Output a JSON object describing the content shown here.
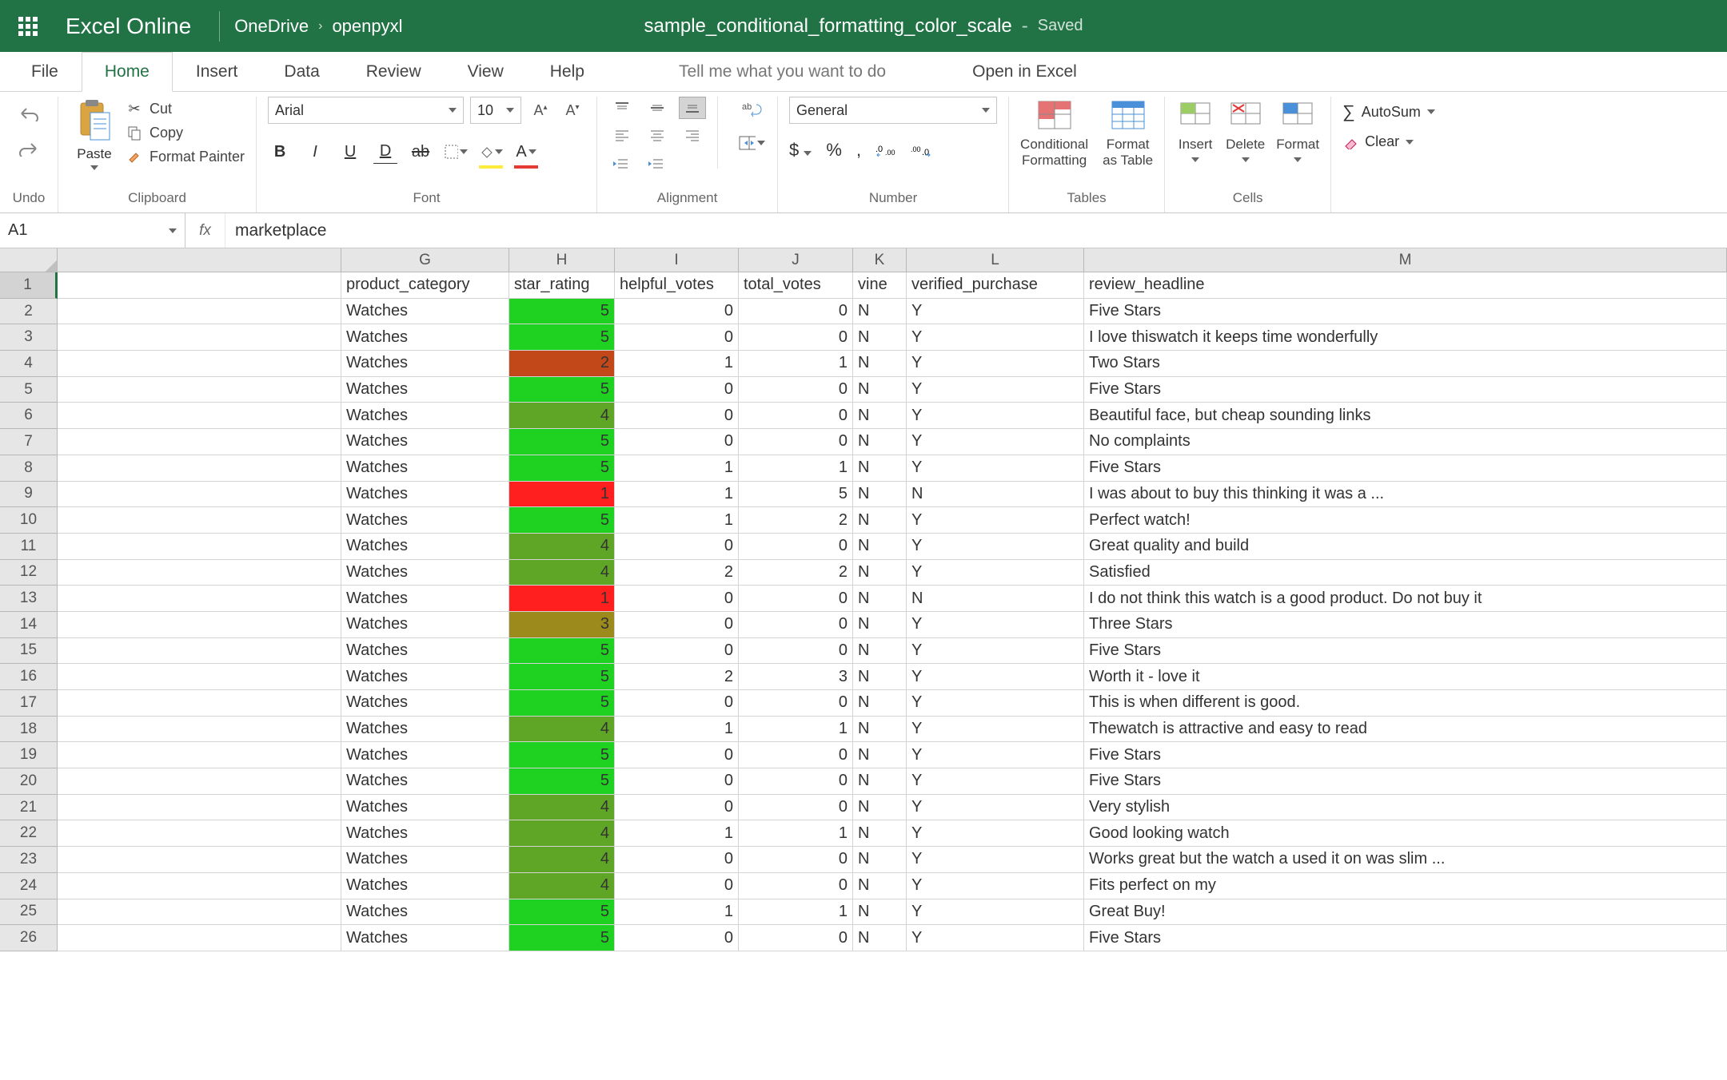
{
  "titlebar": {
    "app_name": "Excel Online",
    "breadcrumb": [
      "OneDrive",
      "openpyxl"
    ],
    "doc_name": "sample_conditional_formatting_color_scale",
    "status": "Saved"
  },
  "tabs": {
    "items": [
      "File",
      "Home",
      "Insert",
      "Data",
      "Review",
      "View",
      "Help"
    ],
    "active": "Home",
    "tell_me": "Tell me what you want to do",
    "open_in_excel": "Open in Excel"
  },
  "ribbon": {
    "undo_label": "Undo",
    "clipboard": {
      "label": "Clipboard",
      "paste": "Paste",
      "cut": "Cut",
      "copy": "Copy",
      "format_painter": "Format Painter"
    },
    "font": {
      "label": "Font",
      "name": "Arial",
      "size": "10"
    },
    "alignment": {
      "label": "Alignment"
    },
    "number": {
      "label": "Number",
      "format": "General"
    },
    "tables": {
      "label": "Tables",
      "conditional_formatting": "Conditional\nFormatting",
      "format_as_table": "Format\nas Table"
    },
    "cells": {
      "label": "Cells",
      "insert": "Insert",
      "delete": "Delete",
      "format": "Format"
    },
    "editing": {
      "autosum": "AutoSum",
      "clear": "Clear"
    }
  },
  "formula_bar": {
    "cell_ref": "A1",
    "fx": "fx",
    "value": "marketplace"
  },
  "columns": [
    "G",
    "H",
    "I",
    "J",
    "K",
    "L",
    "M"
  ],
  "headers": {
    "G": "product_category",
    "H": "star_rating",
    "I": "helpful_votes",
    "J": "total_votes",
    "K": "vine",
    "L": "verified_purchase",
    "M": "review_headline"
  },
  "rows": [
    {
      "n": 2,
      "G": "Watches",
      "H": 5,
      "I": 0,
      "J": 0,
      "K": "N",
      "L": "Y",
      "M": "Five Stars"
    },
    {
      "n": 3,
      "G": "Watches",
      "H": 5,
      "I": 0,
      "J": 0,
      "K": "N",
      "L": "Y",
      "M": "I love thiswatch it keeps time wonderfully"
    },
    {
      "n": 4,
      "G": "Watches",
      "H": 2,
      "I": 1,
      "J": 1,
      "K": "N",
      "L": "Y",
      "M": "Two Stars"
    },
    {
      "n": 5,
      "G": "Watches",
      "H": 5,
      "I": 0,
      "J": 0,
      "K": "N",
      "L": "Y",
      "M": "Five Stars"
    },
    {
      "n": 6,
      "G": "Watches",
      "H": 4,
      "I": 0,
      "J": 0,
      "K": "N",
      "L": "Y",
      "M": "Beautiful face, but cheap sounding links"
    },
    {
      "n": 7,
      "G": "Watches",
      "H": 5,
      "I": 0,
      "J": 0,
      "K": "N",
      "L": "Y",
      "M": "No complaints"
    },
    {
      "n": 8,
      "G": "Watches",
      "H": 5,
      "I": 1,
      "J": 1,
      "K": "N",
      "L": "Y",
      "M": "Five Stars"
    },
    {
      "n": 9,
      "G": "Watches",
      "H": 1,
      "I": 1,
      "J": 5,
      "K": "N",
      "L": "N",
      "M": "I was about to buy this thinking it was a ..."
    },
    {
      "n": 10,
      "G": "Watches",
      "H": 5,
      "I": 1,
      "J": 2,
      "K": "N",
      "L": "Y",
      "M": "Perfect watch!"
    },
    {
      "n": 11,
      "G": "Watches",
      "H": 4,
      "I": 0,
      "J": 0,
      "K": "N",
      "L": "Y",
      "M": "Great quality and build"
    },
    {
      "n": 12,
      "G": "Watches",
      "H": 4,
      "I": 2,
      "J": 2,
      "K": "N",
      "L": "Y",
      "M": "Satisfied"
    },
    {
      "n": 13,
      "G": "Watches",
      "H": 1,
      "I": 0,
      "J": 0,
      "K": "N",
      "L": "N",
      "M": "I do not think this watch is a good product. Do not buy it"
    },
    {
      "n": 14,
      "G": "Watches",
      "H": 3,
      "I": 0,
      "J": 0,
      "K": "N",
      "L": "Y",
      "M": "Three Stars"
    },
    {
      "n": 15,
      "G": "Watches",
      "H": 5,
      "I": 0,
      "J": 0,
      "K": "N",
      "L": "Y",
      "M": "Five Stars"
    },
    {
      "n": 16,
      "G": "Watches",
      "H": 5,
      "I": 2,
      "J": 3,
      "K": "N",
      "L": "Y",
      "M": "Worth it - love it"
    },
    {
      "n": 17,
      "G": "Watches",
      "H": 5,
      "I": 0,
      "J": 0,
      "K": "N",
      "L": "Y",
      "M": "This is when different is good."
    },
    {
      "n": 18,
      "G": "Watches",
      "H": 4,
      "I": 1,
      "J": 1,
      "K": "N",
      "L": "Y",
      "M": "Thewatch is attractive and easy to read"
    },
    {
      "n": 19,
      "G": "Watches",
      "H": 5,
      "I": 0,
      "J": 0,
      "K": "N",
      "L": "Y",
      "M": "Five Stars"
    },
    {
      "n": 20,
      "G": "Watches",
      "H": 5,
      "I": 0,
      "J": 0,
      "K": "N",
      "L": "Y",
      "M": "Five Stars"
    },
    {
      "n": 21,
      "G": "Watches",
      "H": 4,
      "I": 0,
      "J": 0,
      "K": "N",
      "L": "Y",
      "M": "Very stylish"
    },
    {
      "n": 22,
      "G": "Watches",
      "H": 4,
      "I": 1,
      "J": 1,
      "K": "N",
      "L": "Y",
      "M": "Good looking watch"
    },
    {
      "n": 23,
      "G": "Watches",
      "H": 4,
      "I": 0,
      "J": 0,
      "K": "N",
      "L": "Y",
      "M": "Works great but the watch a used it on was slim ..."
    },
    {
      "n": 24,
      "G": "Watches",
      "H": 4,
      "I": 0,
      "J": 0,
      "K": "N",
      "L": "Y",
      "M": "Fits perfect on my"
    },
    {
      "n": 25,
      "G": "Watches",
      "H": 5,
      "I": 1,
      "J": 1,
      "K": "N",
      "L": "Y",
      "M": "Great Buy!"
    },
    {
      "n": 26,
      "G": "Watches",
      "H": 5,
      "I": 0,
      "J": 0,
      "K": "N",
      "L": "Y",
      "M": "Five Stars"
    }
  ],
  "color_scale": {
    "1": "#ff1f1f",
    "2": "#c2481a",
    "3": "#9c8a1d",
    "4": "#5fa626",
    "5": "#1fd221"
  }
}
